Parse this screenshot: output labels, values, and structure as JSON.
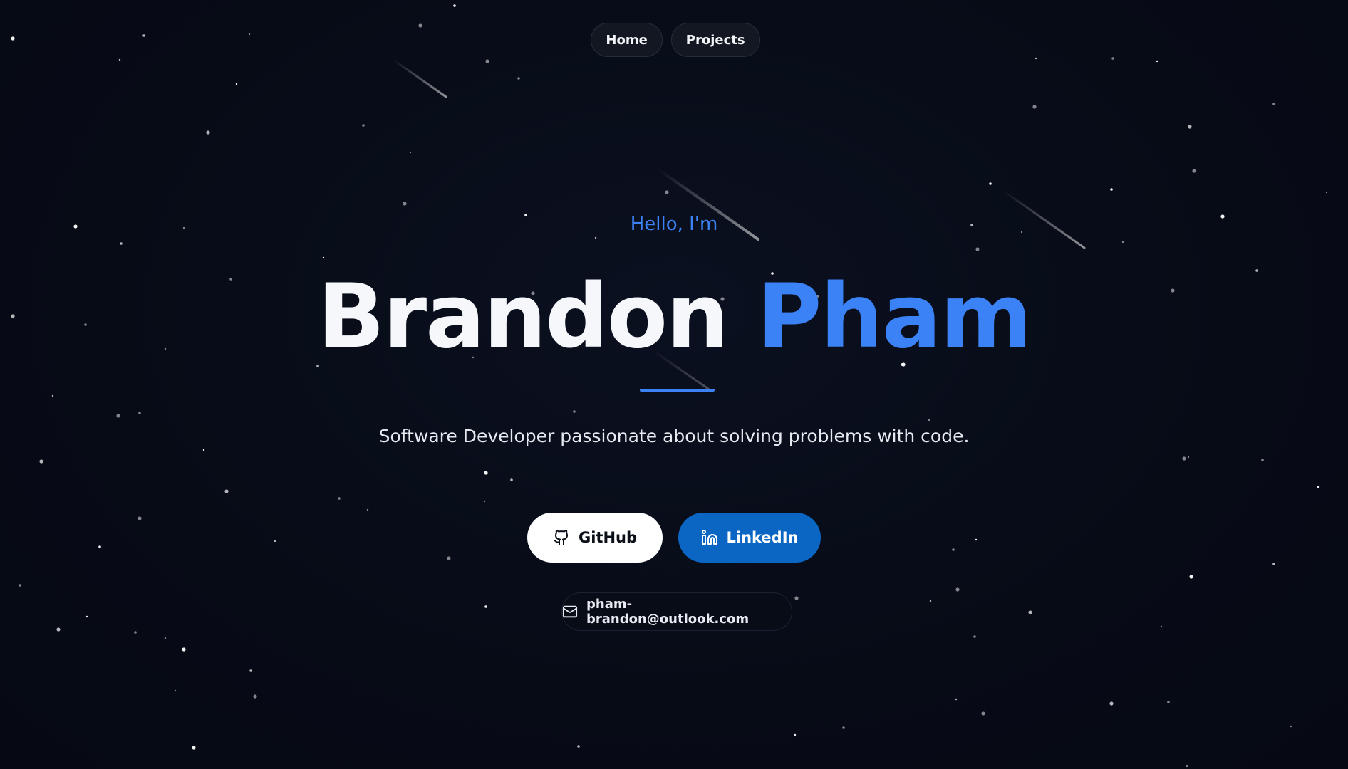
{
  "nav": {
    "items": [
      {
        "label": "Home"
      },
      {
        "label": "Projects"
      }
    ]
  },
  "hero": {
    "greeting": "Hello, I'm",
    "first_name": "Brandon",
    "last_name": "Pham",
    "tagline": "Software Developer passionate about solving problems with code."
  },
  "links": {
    "github": {
      "label": "GitHub",
      "icon": "github-icon"
    },
    "linkedin": {
      "label": "LinkedIn",
      "icon": "linkedin-icon"
    }
  },
  "contact": {
    "email": "pham-brandon@outlook.com",
    "icon": "mail-icon"
  },
  "colors": {
    "background": "#070b16",
    "accent": "#3b82f6",
    "linkedin": "#0a66c2",
    "text": "#f6f7fb"
  }
}
